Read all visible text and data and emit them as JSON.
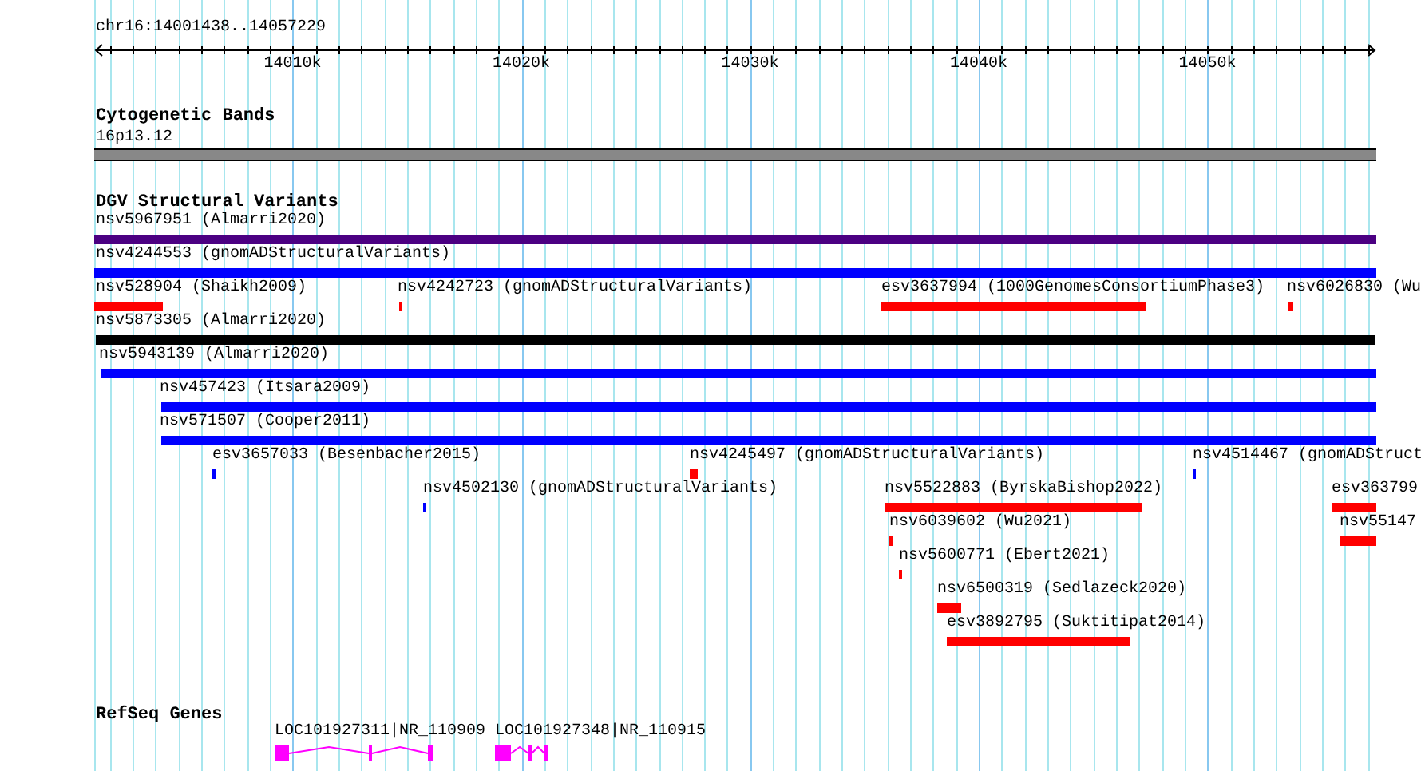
{
  "ruler": {
    "title": "chr16:14001438..14057229",
    "tick_labels": [
      "14010k",
      "14020k",
      "14030k",
      "14040k",
      "14050k"
    ]
  },
  "tracks": [
    {
      "title": "Cytogenetic Bands",
      "kind": "bands",
      "features": [
        {
          "label": "16p13.12"
        }
      ]
    },
    {
      "title": "DGV Structural Variants",
      "kind": "variants",
      "features": [
        {
          "label": "nsv5967951 (Almarri2020)",
          "color": "#4b0082"
        },
        {
          "label": "nsv4244553 (gnomADStructuralVariants)",
          "color": "#0000ff"
        },
        {
          "label": "nsv528904 (Shaikh2009)",
          "color": "#ff0000"
        },
        {
          "label": "nsv4242723 (gnomADStructuralVariants)",
          "color": "#ff0000"
        },
        {
          "label": "esv3637994 (1000GenomesConsortiumPhase3)",
          "color": "#ff0000"
        },
        {
          "label": "nsv6026830 (Wu",
          "color": "#ff0000"
        },
        {
          "label": "nsv5873305 (Almarri2020)",
          "color": "#000000"
        },
        {
          "label": "nsv5943139 (Almarri2020)",
          "color": "#0000ff"
        },
        {
          "label": "nsv457423 (Itsara2009)",
          "color": "#0000ff"
        },
        {
          "label": "nsv571507 (Cooper2011)",
          "color": "#0000ff"
        },
        {
          "label": "esv3657033 (Besenbacher2015)",
          "color": "#0000ff"
        },
        {
          "label": "nsv4245497 (gnomADStructuralVariants)",
          "color": "#ff0000"
        },
        {
          "label": "nsv4514467 (gnomADStruct",
          "color": "#0000ff"
        },
        {
          "label": "nsv4502130 (gnomADStructuralVariants)",
          "color": "#0000ff"
        },
        {
          "label": "nsv5522883 (ByrskaBishop2022)",
          "color": "#ff0000"
        },
        {
          "label": "esv363799",
          "color": "#ff0000"
        },
        {
          "label": "nsv6039602 (Wu2021)",
          "color": "#ff0000"
        },
        {
          "label": "nsv55147",
          "color": "#ff0000"
        },
        {
          "label": "nsv5600771 (Ebert2021)",
          "color": "#ff0000"
        },
        {
          "label": "nsv6500319 (Sedlazeck2020)",
          "color": "#ff0000"
        },
        {
          "label": "esv3892795 (Suktitipat2014)",
          "color": "#ff0000"
        }
      ]
    },
    {
      "title": "RefSeq Genes",
      "kind": "genes",
      "features": [
        {
          "label": "LOC101927311|NR_110909"
        },
        {
          "label": "LOC101927348|NR_110915"
        }
      ]
    }
  ]
}
